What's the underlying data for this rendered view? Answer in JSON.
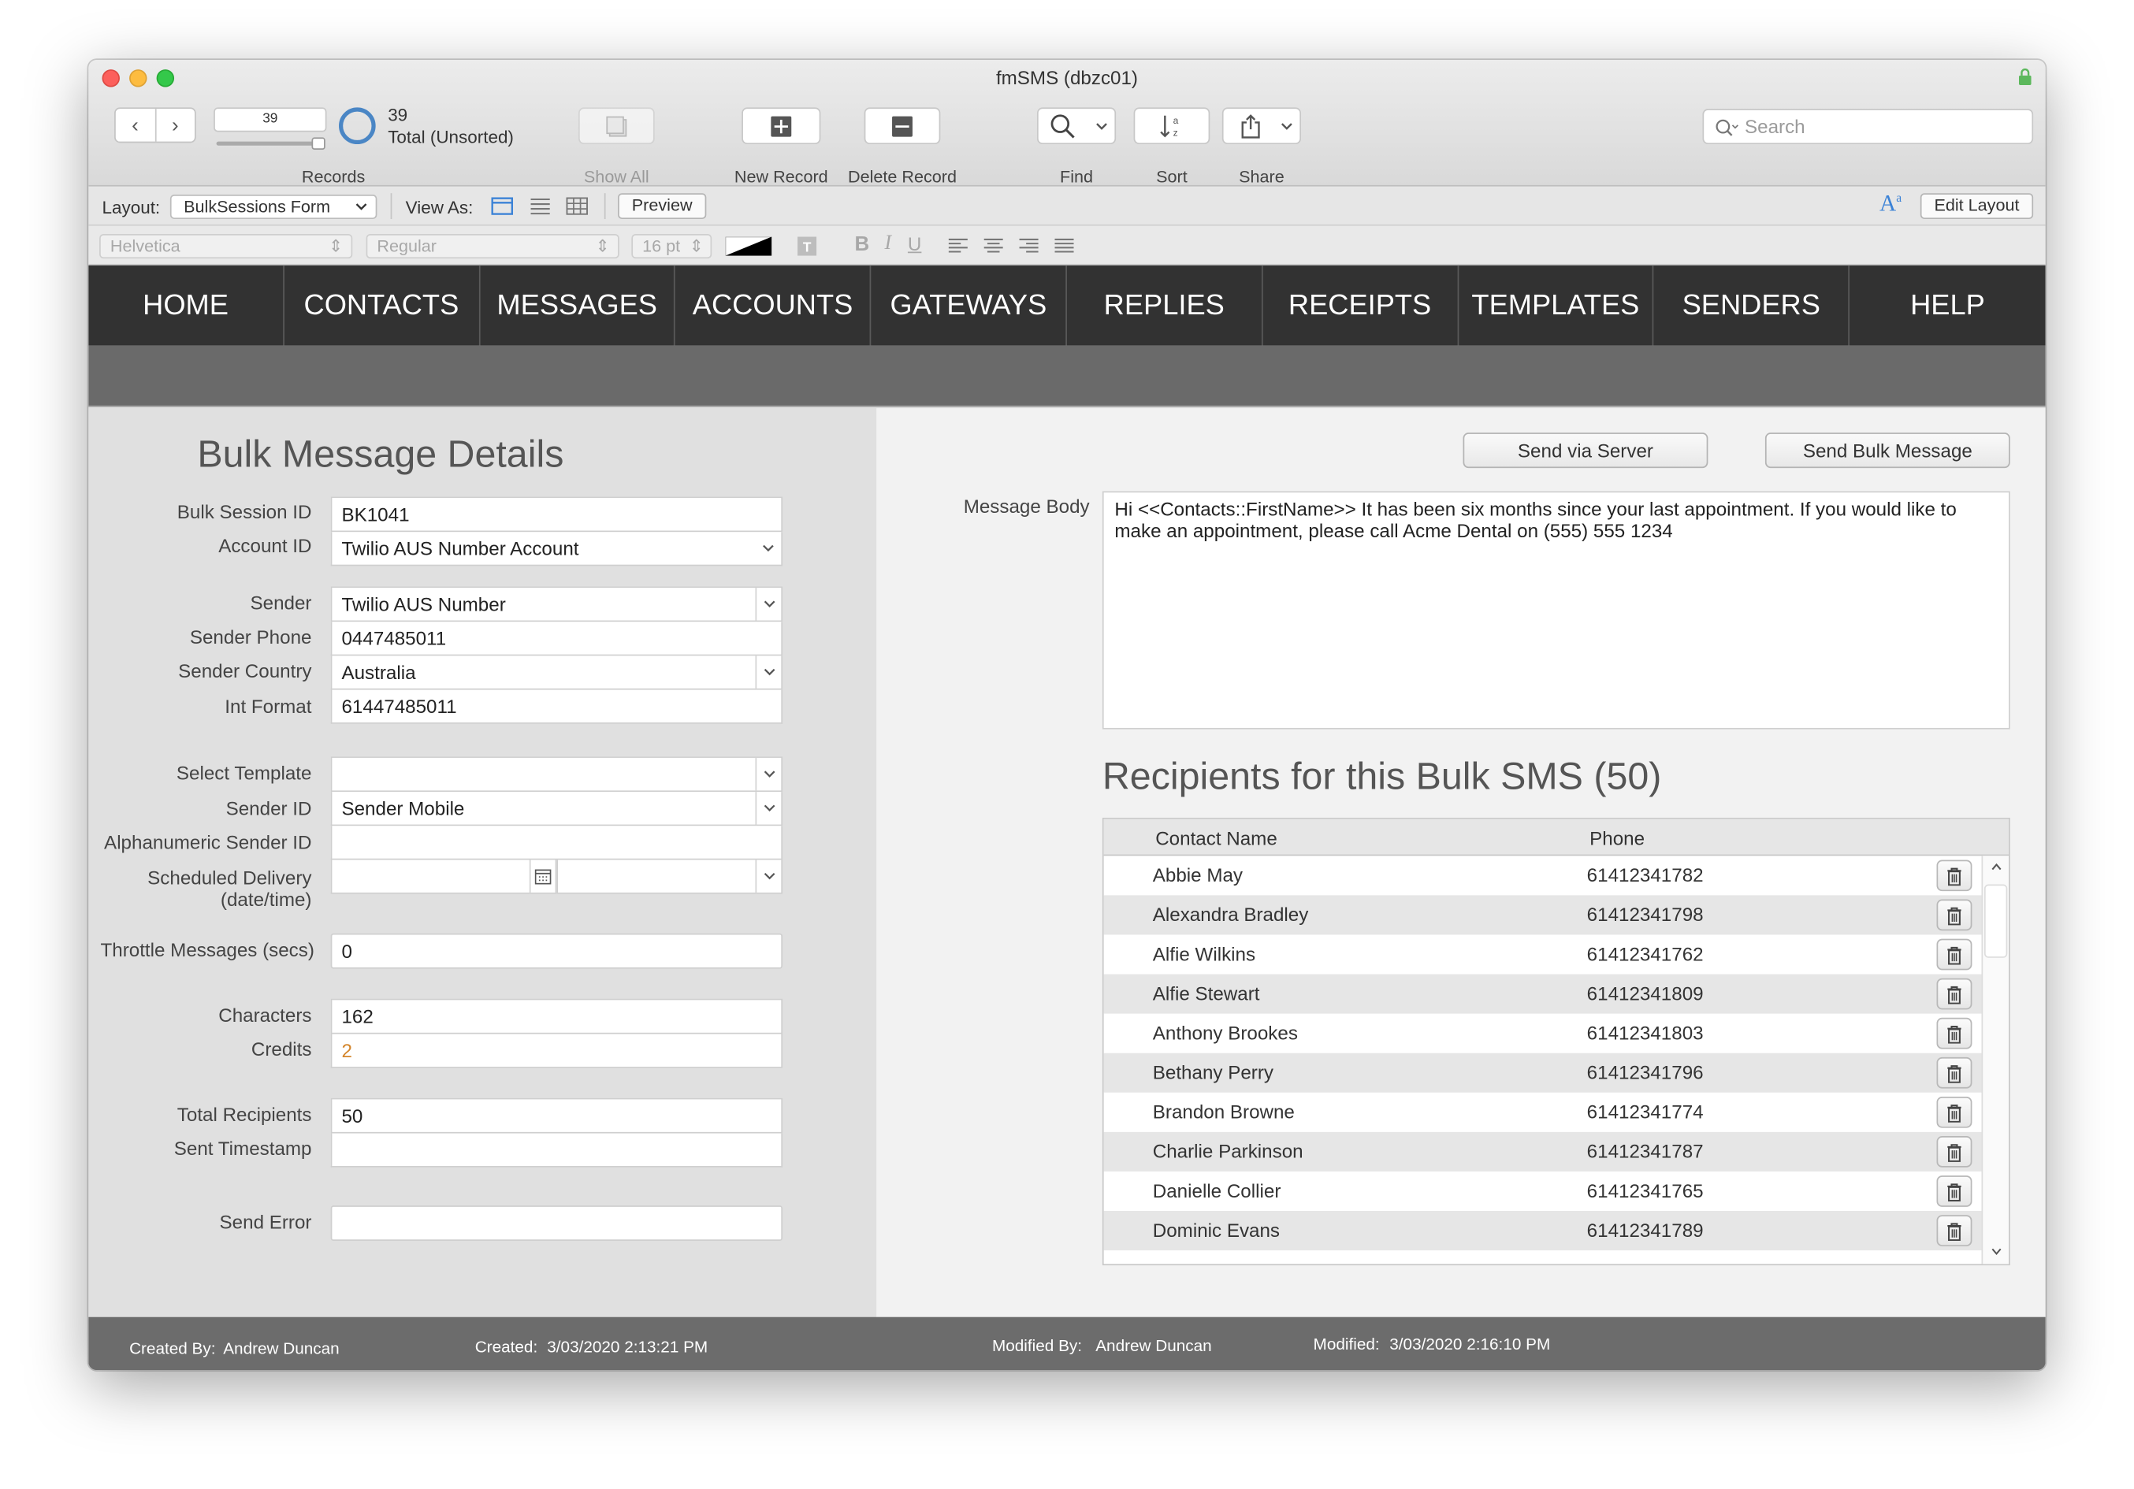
{
  "window": {
    "title": "fmSMS (dbzc01)"
  },
  "toolbar": {
    "record_number": "39",
    "records_label": "Records",
    "record_count": "39",
    "record_status": "Total (Unsorted)",
    "show_all": "Show All",
    "new_record": "New Record",
    "delete_record": "Delete Record",
    "find": "Find",
    "sort": "Sort",
    "share": "Share",
    "search_placeholder": "Search"
  },
  "layoutbar": {
    "layout_label": "Layout:",
    "layout_value": "BulkSessions Form",
    "view_as_label": "View As:",
    "preview": "Preview",
    "edit_layout": "Edit Layout"
  },
  "formatbar": {
    "font": "Helvetica",
    "style": "Regular",
    "size": "16 pt"
  },
  "nav": [
    "HOME",
    "CONTACTS",
    "MESSAGES",
    "ACCOUNTS",
    "GATEWAYS",
    "REPLIES",
    "RECEIPTS",
    "TEMPLATES",
    "SENDERS",
    "HELP"
  ],
  "form": {
    "title": "Bulk Message Details",
    "labels": {
      "bulk_session_id": "Bulk Session ID",
      "account_id": "Account ID",
      "sender": "Sender",
      "sender_phone": "Sender Phone",
      "sender_country": "Sender Country",
      "int_format": "Int Format",
      "select_template": "Select Template",
      "sender_id": "Sender ID",
      "alpha_sender_id": "Alphanumeric Sender ID",
      "scheduled_delivery": "Scheduled Delivery",
      "scheduled_delivery_sub": "(date/time)",
      "throttle": "Throttle Messages (secs)",
      "characters": "Characters",
      "credits": "Credits",
      "total_recipients": "Total Recipients",
      "sent_timestamp": "Sent Timestamp",
      "send_error": "Send Error"
    },
    "values": {
      "bulk_session_id": "BK1041",
      "account_id": "Twilio AUS Number Account",
      "sender": "Twilio AUS Number",
      "sender_phone": "0447485011",
      "sender_country": "Australia",
      "int_format": "61447485011",
      "select_template": "",
      "sender_id": "Sender Mobile",
      "alpha_sender_id": "",
      "throttle": "0",
      "characters": "162",
      "credits": "2",
      "total_recipients": "50",
      "sent_timestamp": "",
      "send_error": ""
    },
    "credits_color": "#d4862c"
  },
  "right": {
    "send_via_server": "Send via Server",
    "send_bulk": "Send Bulk Message",
    "message_body_label": "Message Body",
    "message_body": "Hi <<Contacts::FirstName>> It has been six months since your last appointment. If you would like to make an appointment, please call Acme Dental on (555) 555 1234",
    "recipients_title": "Recipients for this Bulk SMS (50)",
    "columns": [
      "Contact Name",
      "Phone"
    ],
    "recipients": [
      {
        "name": "Abbie May",
        "phone": "61412341782"
      },
      {
        "name": "Alexandra Bradley",
        "phone": "61412341798"
      },
      {
        "name": "Alfie Wilkins",
        "phone": "61412341762"
      },
      {
        "name": "Alfie Stewart",
        "phone": "61412341809"
      },
      {
        "name": "Anthony Brookes",
        "phone": "61412341803"
      },
      {
        "name": "Bethany Perry",
        "phone": "61412341796"
      },
      {
        "name": "Brandon Browne",
        "phone": "61412341774"
      },
      {
        "name": "Charlie Parkinson",
        "phone": "61412341787"
      },
      {
        "name": "Danielle Collier",
        "phone": "61412341765"
      },
      {
        "name": "Dominic Evans",
        "phone": "61412341789"
      }
    ]
  },
  "footer": {
    "created_by_label": "Created By:",
    "created_by": "Andrew Duncan",
    "created_label": "Created:",
    "created": "3/03/2020 2:13:21 PM",
    "modified_by_label": "Modified By:",
    "modified_by": "Andrew Duncan",
    "modified_label": "Modified:",
    "modified": "3/03/2020 2:16:10 PM"
  }
}
